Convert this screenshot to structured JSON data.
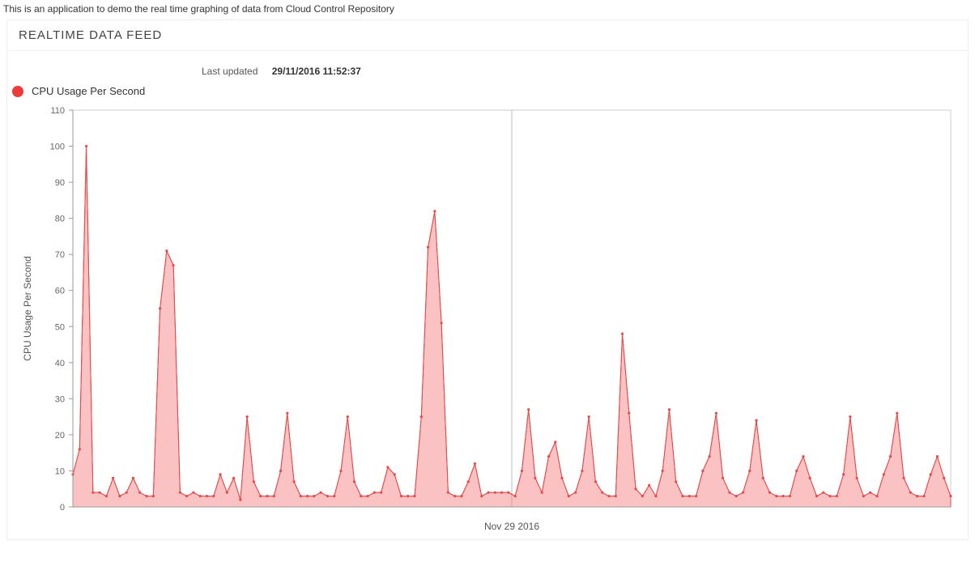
{
  "app_description": "This is an application to demo the real time graphing of data from Cloud Control Repository",
  "panel_title": "REALTIME DATA FEED",
  "updated": {
    "label": "Last updated",
    "value": "29/11/2016 11:52:37"
  },
  "legend": {
    "label": "CPU Usage Per Second",
    "color": "#ee3a3a"
  },
  "chart_data": {
    "type": "area",
    "title": "",
    "xlabel": "Nov 29 2016",
    "ylabel": "CPU Usage Per Second",
    "ylim": [
      0,
      110
    ],
    "yticks": [
      0,
      10,
      20,
      30,
      40,
      50,
      60,
      70,
      80,
      90,
      100,
      110
    ],
    "series": [
      {
        "name": "CPU Usage Per Second",
        "color": "#e84a4a",
        "values": [
          9,
          16,
          100,
          4,
          4,
          3,
          8,
          3,
          4,
          8,
          4,
          3,
          3,
          55,
          71,
          67,
          4,
          3,
          4,
          3,
          3,
          3,
          9,
          4,
          8,
          2,
          25,
          7,
          3,
          3,
          3,
          10,
          26,
          7,
          3,
          3,
          3,
          4,
          3,
          3,
          10,
          25,
          7,
          3,
          3,
          4,
          4,
          11,
          9,
          3,
          3,
          3,
          25,
          72,
          82,
          51,
          4,
          3,
          3,
          7,
          12,
          3,
          4,
          4,
          4,
          4,
          3,
          10,
          27,
          8,
          4,
          14,
          18,
          8,
          3,
          4,
          10,
          25,
          7,
          4,
          3,
          3,
          48,
          26,
          5,
          3,
          6,
          3,
          10,
          27,
          7,
          3,
          3,
          3,
          10,
          14,
          26,
          8,
          4,
          3,
          4,
          10,
          24,
          8,
          4,
          3,
          3,
          3,
          10,
          14,
          8,
          3,
          4,
          3,
          3,
          9,
          25,
          8,
          3,
          4,
          3,
          9,
          14,
          26,
          8,
          4,
          3,
          3,
          9,
          14,
          8,
          3
        ]
      }
    ]
  }
}
